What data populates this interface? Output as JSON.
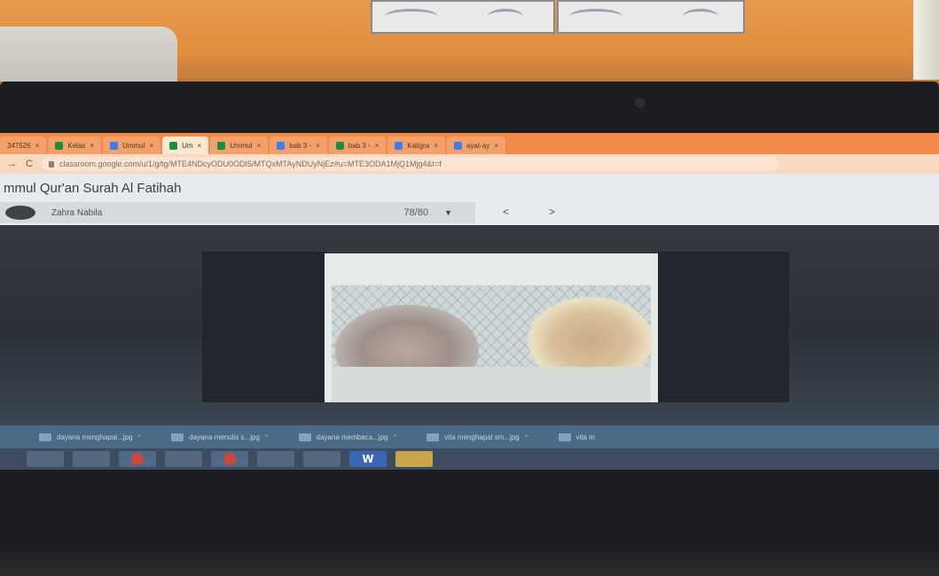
{
  "browser": {
    "tabs": [
      {
        "label": "347526",
        "icon": "page-icon"
      },
      {
        "label": "Kelas",
        "icon": "classroom-icon"
      },
      {
        "label": "Ummul",
        "icon": "drive-icon"
      },
      {
        "label": "Um",
        "icon": "classroom-icon",
        "active": true
      },
      {
        "label": "Ummul",
        "icon": "classroom-icon"
      },
      {
        "label": "bab 3 -",
        "icon": "drive-icon"
      },
      {
        "label": "bab 3 -",
        "icon": "classroom-icon"
      },
      {
        "label": "Kaligra",
        "icon": "pencil-icon"
      },
      {
        "label": "ayat-ay",
        "icon": "drive-icon"
      }
    ],
    "close_glyph": "×",
    "back_glyph": "→",
    "reload_glyph": "C",
    "url": "classroom.google.com/u/1/g/tg/MTE4NDcyODU0ODI5/MTQxMTAyNDUyNjEz#u=MTE3ODA1MjQ1Mjg4&t=f"
  },
  "grader": {
    "title": "mmul Qur'an Surah Al Fatihah",
    "student_name": "Zahra Nabila",
    "score": "78/80",
    "dropdown_glyph": "▼",
    "prev_glyph": "<",
    "next_glyph": ">"
  },
  "downloads": [
    {
      "name": "dayana menghapal...jpg"
    },
    {
      "name": "dayana menulis s...jpg"
    },
    {
      "name": "dayana membaca...jpg"
    },
    {
      "name": "vita menghapal sm...jpg"
    },
    {
      "name": "vita m"
    }
  ],
  "downloads_caret": "^",
  "taskbar": {
    "word_label": "W"
  }
}
